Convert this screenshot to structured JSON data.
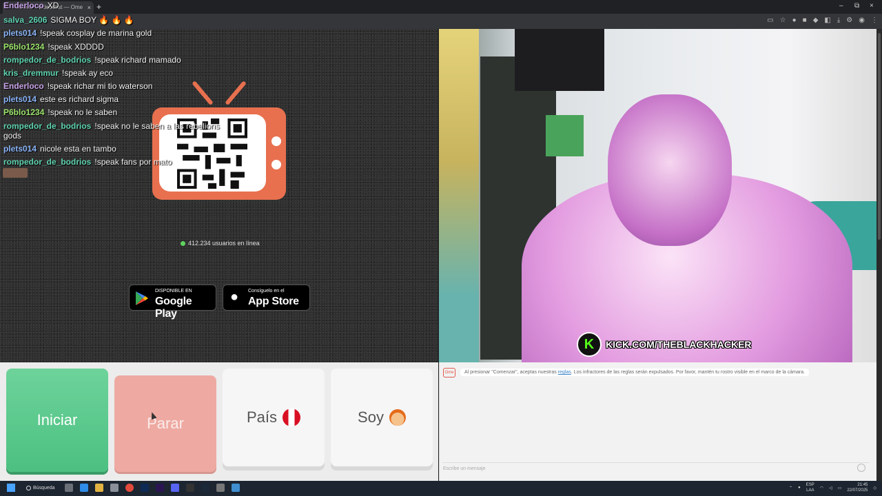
{
  "browser": {
    "tab_title": "Ome.tv - Videochat — Ome",
    "tab_close": "×",
    "new_tab": "+",
    "window_controls": [
      "–",
      "⧉",
      "×"
    ]
  },
  "chat": [
    {
      "user": "Enderloco",
      "text": "XD",
      "color": "purple"
    },
    {
      "user": "salva_2606",
      "text": "SIGMA BOY 🔥 🔥 🔥",
      "color": "teal"
    },
    {
      "user": "plets014",
      "text": "!speak cosplay de marina gold",
      "color": "blue"
    },
    {
      "user": "P6blo1234",
      "text": "!speak XDDDD",
      "color": "green"
    },
    {
      "user": "rompedor_de_bodrios",
      "text": "!speak richard mamado",
      "color": "teal"
    },
    {
      "user": "kris_dremmur",
      "text": "!speak ay eco",
      "color": "teal"
    },
    {
      "user": "Enderloco",
      "text": "!speak richar mi tio waterson",
      "color": "purple"
    },
    {
      "user": "plets014",
      "text": "este es richard sigma",
      "color": "blue"
    },
    {
      "user": "P6blo1234",
      "text": "!speak no le saben",
      "color": "green"
    },
    {
      "user": "rompedor_de_bodrios",
      "text": "!speak no le saben a las rebelions gods",
      "color": "teal"
    },
    {
      "user": "plets014",
      "text": "nicole esta en tambo",
      "color": "blue"
    },
    {
      "user": "rompedor_de_bodrios",
      "text": "!speak fans por mato",
      "color": "teal"
    }
  ],
  "site": {
    "online_count": "412.234 usuarios en línea",
    "google_play": {
      "small": "DISPONIBLE EN",
      "big": "Google Play"
    },
    "app_store": {
      "small": "Consíguelo en el",
      "big": "App Store"
    }
  },
  "stream": {
    "kick_logo": "K",
    "kick_url": "KICK.COM/THEBLACKHACKER"
  },
  "controls": {
    "start": "Iniciar",
    "stop": "Parar",
    "country": "País",
    "soy": "Soy"
  },
  "chat_panel": {
    "badge": "Ome",
    "message_before": "Al presionar \"Comenzar\", aceptas nuestras ",
    "message_link": "reglas",
    "message_after": ". Los infractores de las reglas serán expulsados. Por favor, mantén tu rostro visible en el marco de la cámara.",
    "input_placeholder": "Escribe un mensaje"
  },
  "taskbar": {
    "search": "Búsqueda",
    "lang_1": "ESP",
    "lang_2": "LAA",
    "time": "21:45",
    "date": "22/07/2025"
  },
  "colors": {
    "start_green": "#4cc081",
    "stop_red": "#eeaaa2",
    "tv_orange": "#e8704f",
    "kick_green": "#53fc18"
  }
}
